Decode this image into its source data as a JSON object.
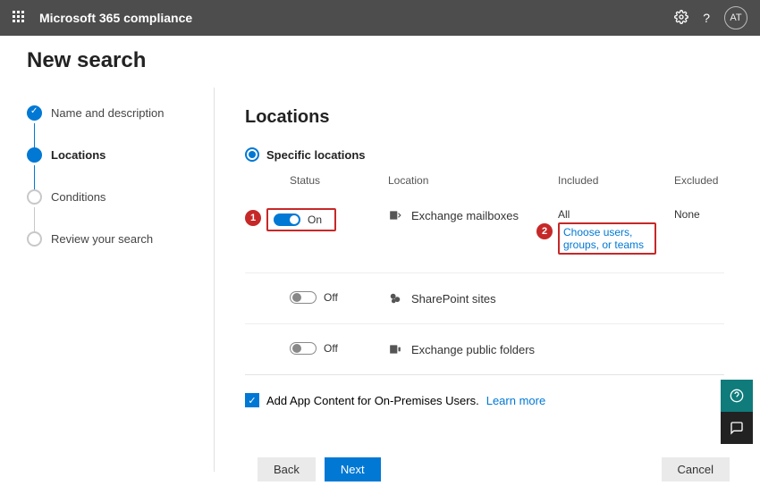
{
  "header": {
    "title": "Microsoft 365 compliance",
    "avatar": "AT"
  },
  "page_title": "New search",
  "sidebar": {
    "steps": [
      {
        "label": "Name and description"
      },
      {
        "label": "Locations"
      },
      {
        "label": "Conditions"
      },
      {
        "label": "Review your search"
      }
    ]
  },
  "main": {
    "heading": "Locations",
    "radio_label": "Specific locations",
    "columns": {
      "status": "Status",
      "location": "Location",
      "included": "Included",
      "excluded": "Excluded"
    },
    "rows": [
      {
        "status": "On",
        "location": "Exchange mailboxes",
        "included": "All",
        "included_link": "Choose users, groups, or teams",
        "excluded": "None"
      },
      {
        "status": "Off",
        "location": "SharePoint sites",
        "included": "",
        "included_link": "",
        "excluded": ""
      },
      {
        "status": "Off",
        "location": "Exchange public folders",
        "included": "",
        "included_link": "",
        "excluded": ""
      }
    ],
    "checkbox_label": "Add App Content for On-Premises Users.",
    "learn_more": "Learn more"
  },
  "footer": {
    "back": "Back",
    "next": "Next",
    "cancel": "Cancel"
  },
  "callouts": {
    "one": "1",
    "two": "2"
  }
}
